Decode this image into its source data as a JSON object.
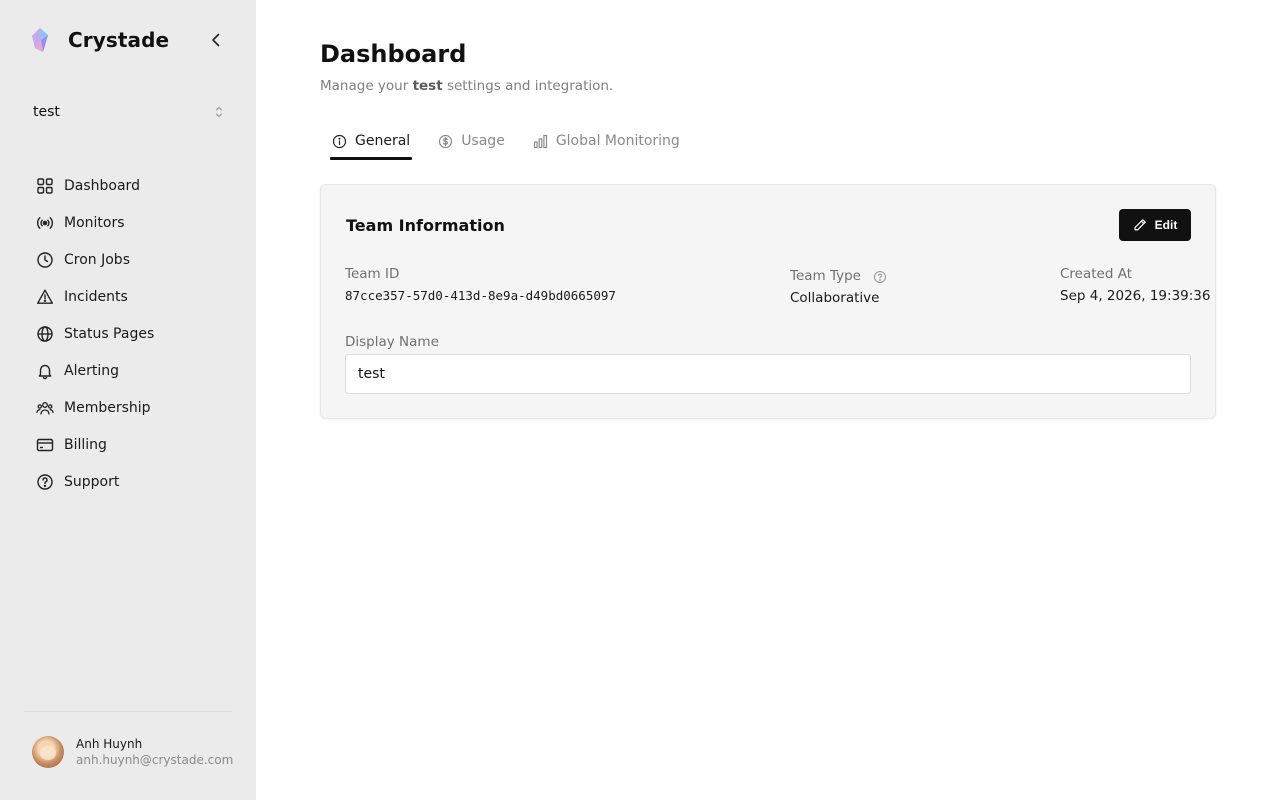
{
  "brand": {
    "name": "Crystade"
  },
  "team_selector": {
    "value": "test"
  },
  "nav": {
    "items": [
      {
        "label": "Dashboard",
        "icon": "dashboard-grid-icon"
      },
      {
        "label": "Monitors",
        "icon": "broadcast-icon"
      },
      {
        "label": "Cron Jobs",
        "icon": "clock-icon"
      },
      {
        "label": "Incidents",
        "icon": "warning-icon"
      },
      {
        "label": "Status Pages",
        "icon": "globe-icon"
      },
      {
        "label": "Alerting",
        "icon": "bell-icon"
      },
      {
        "label": "Membership",
        "icon": "users-icon"
      },
      {
        "label": "Billing",
        "icon": "credit-card-icon"
      },
      {
        "label": "Support",
        "icon": "help-circle-icon"
      }
    ]
  },
  "user": {
    "name": "Anh Huynh",
    "email": "anh.huynh@crystade.com"
  },
  "page": {
    "title": "Dashboard",
    "subtitle_prefix": "Manage your ",
    "subtitle_team": "test",
    "subtitle_suffix": " settings and integration."
  },
  "tabs": [
    {
      "label": "General",
      "icon": "info-icon",
      "active": true
    },
    {
      "label": "Usage",
      "icon": "dollar-circle-icon",
      "active": false
    },
    {
      "label": "Global Monitoring",
      "icon": "bar-chart-icon",
      "active": false
    }
  ],
  "card": {
    "title": "Team Information",
    "edit_label": "Edit",
    "team_id_label": "Team ID",
    "team_id": "87cce357-57d0-413d-8e9a-d49bd0665097",
    "team_type_label": "Team Type",
    "team_type": "Collaborative",
    "created_at_label": "Created At",
    "created_at": "Sep 4, 2026, 19:39:36",
    "display_name_label": "Display Name",
    "display_name": "test"
  },
  "colors": {
    "sidebar_bg": "#ebebeb",
    "accent": "#111111",
    "muted_text": "#808080",
    "card_bg": "#f5f5f5"
  }
}
